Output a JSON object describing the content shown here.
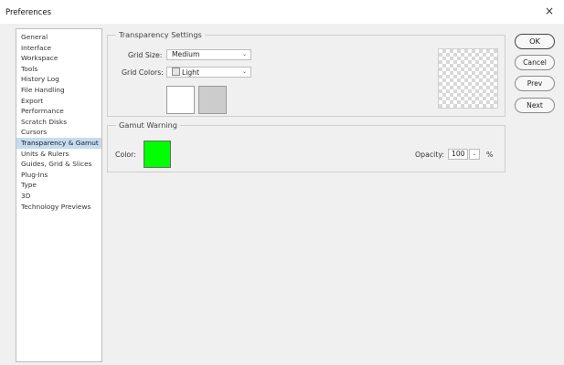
{
  "window": {
    "title": "Preferences",
    "close_glyph": "×"
  },
  "sidebar": {
    "items": [
      {
        "label": "General"
      },
      {
        "label": "Interface"
      },
      {
        "label": "Workspace"
      },
      {
        "label": "Tools"
      },
      {
        "label": "History Log"
      },
      {
        "label": "File Handling"
      },
      {
        "label": "Export"
      },
      {
        "label": "Performance"
      },
      {
        "label": "Scratch Disks"
      },
      {
        "label": "Cursors"
      },
      {
        "label": "Transparency & Gamut",
        "selected": true
      },
      {
        "label": "Units & Rulers"
      },
      {
        "label": "Guides, Grid & Slices"
      },
      {
        "label": "Plug-Ins"
      },
      {
        "label": "Type"
      },
      {
        "label": "3D"
      },
      {
        "label": "Technology Previews"
      }
    ]
  },
  "transparency": {
    "legend": "Transparency Settings",
    "grid_size_label": "Grid Size:",
    "grid_size_value": "Medium",
    "grid_colors_label": "Grid Colors:",
    "grid_colors_value": "Light",
    "swatch1_color": "#ffffff",
    "swatch2_color": "#cccccc"
  },
  "gamut": {
    "legend": "Gamut Warning",
    "color_label": "Color:",
    "color_value": "#00ff00",
    "opacity_label": "Opacity:",
    "opacity_value": "100",
    "opacity_unit": "%"
  },
  "buttons": {
    "ok": "OK",
    "cancel": "Cancel",
    "prev": "Prev",
    "next": "Next"
  },
  "icons": {
    "chevron": "chevron-down-icon",
    "close": "close-icon"
  }
}
